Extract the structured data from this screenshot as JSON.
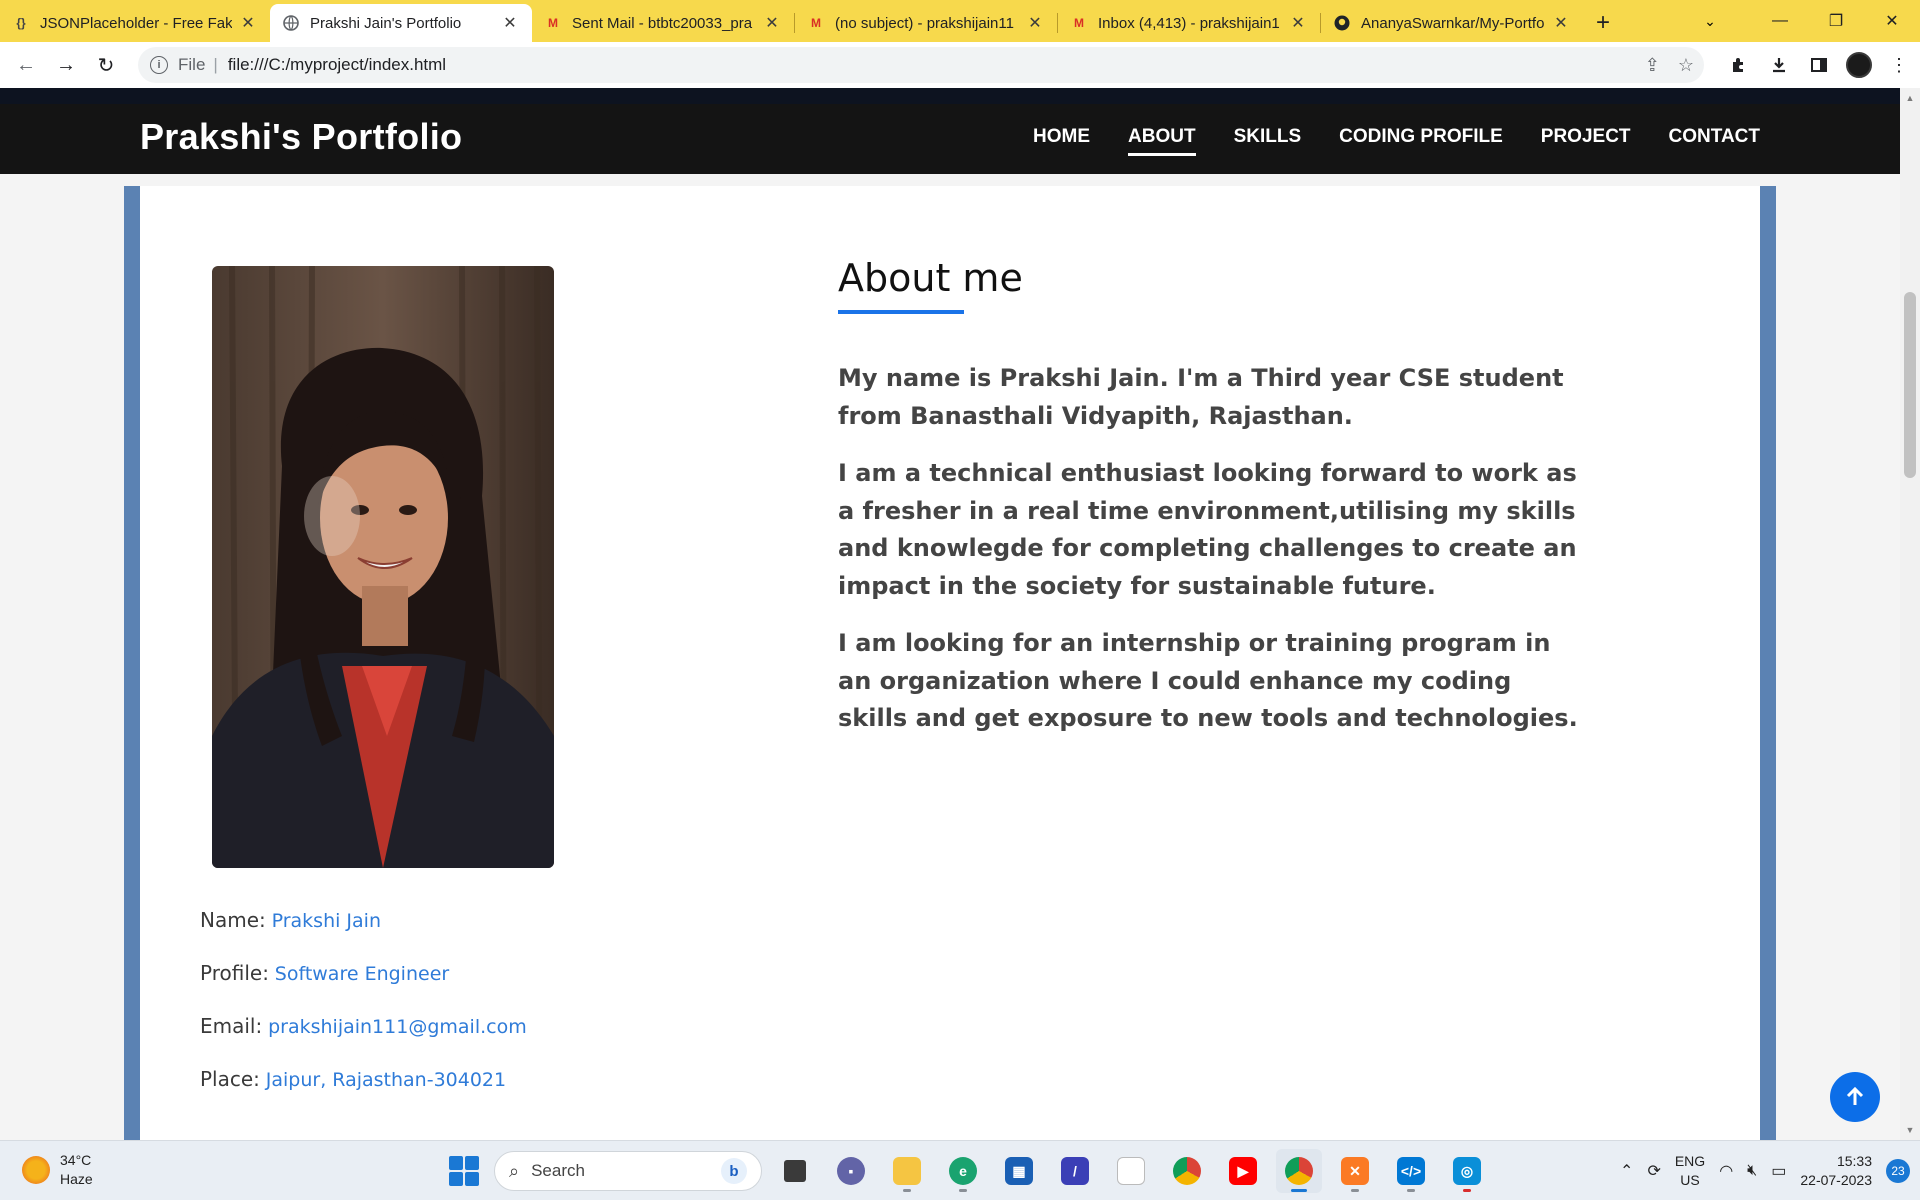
{
  "browser": {
    "tabs": [
      {
        "title": "JSONPlaceholder - Free Fak",
        "icon": "placeholder-icon",
        "active": false
      },
      {
        "title": "Prakshi Jain's Portfolio",
        "icon": "globe-icon",
        "active": true
      },
      {
        "title": "Sent Mail - btbtc20033_pra",
        "icon": "gmail-icon",
        "active": false
      },
      {
        "title": "(no subject) - prakshijain11",
        "icon": "gmail-icon",
        "active": false
      },
      {
        "title": "Inbox (4,413) - prakshijain1",
        "icon": "gmail-icon",
        "active": false
      },
      {
        "title": "AnanyaSwarnkar/My-Portfo",
        "icon": "github-icon",
        "active": false
      }
    ],
    "address": {
      "scheme": "File",
      "url": "file:///C:/myproject/index.html"
    }
  },
  "site": {
    "brand": "Prakshi's Portfolio",
    "nav": [
      {
        "label": "HOME",
        "active": false
      },
      {
        "label": "ABOUT",
        "active": true
      },
      {
        "label": "SKILLS",
        "active": false
      },
      {
        "label": "CODING PROFILE",
        "active": false
      },
      {
        "label": "PROJECT",
        "active": false
      },
      {
        "label": "CONTACT",
        "active": false
      }
    ]
  },
  "about": {
    "heading": "About me",
    "paragraphs": [
      "My name is Prakshi Jain. I'm a Third year CSE student from Banasthali Vidyapith, Rajasthan.",
      "I am a technical enthusiast looking forward to work as a fresher in a real time environment,utilising my skills and knowlegde for completing challenges to create an impact in the society for sustainable future.",
      "I am looking for an internship or training program in an organization where I could enhance my coding skills and get exposure to new tools and technologies."
    ],
    "details": [
      {
        "label": "Name:",
        "value": "Prakshi Jain"
      },
      {
        "label": "Profile:",
        "value": "Software Engineer"
      },
      {
        "label": "Email:",
        "value": "prakshijain111@gmail.com"
      },
      {
        "label": "Place:",
        "value": "Jaipur, Rajasthan-304021"
      }
    ]
  },
  "taskbar": {
    "weather": {
      "temp": "34°C",
      "condition": "Haze"
    },
    "search_label": "Search",
    "tray": {
      "lang": "ENG",
      "region": "US",
      "time": "15:33",
      "date": "22-07-2023",
      "notifications": "23"
    }
  },
  "colors": {
    "nav_bg": "#141414",
    "accent": "#1a73e8",
    "link": "#2f7bd8",
    "frame": "#5b82b3",
    "tabstrip": "#f7d94c"
  }
}
